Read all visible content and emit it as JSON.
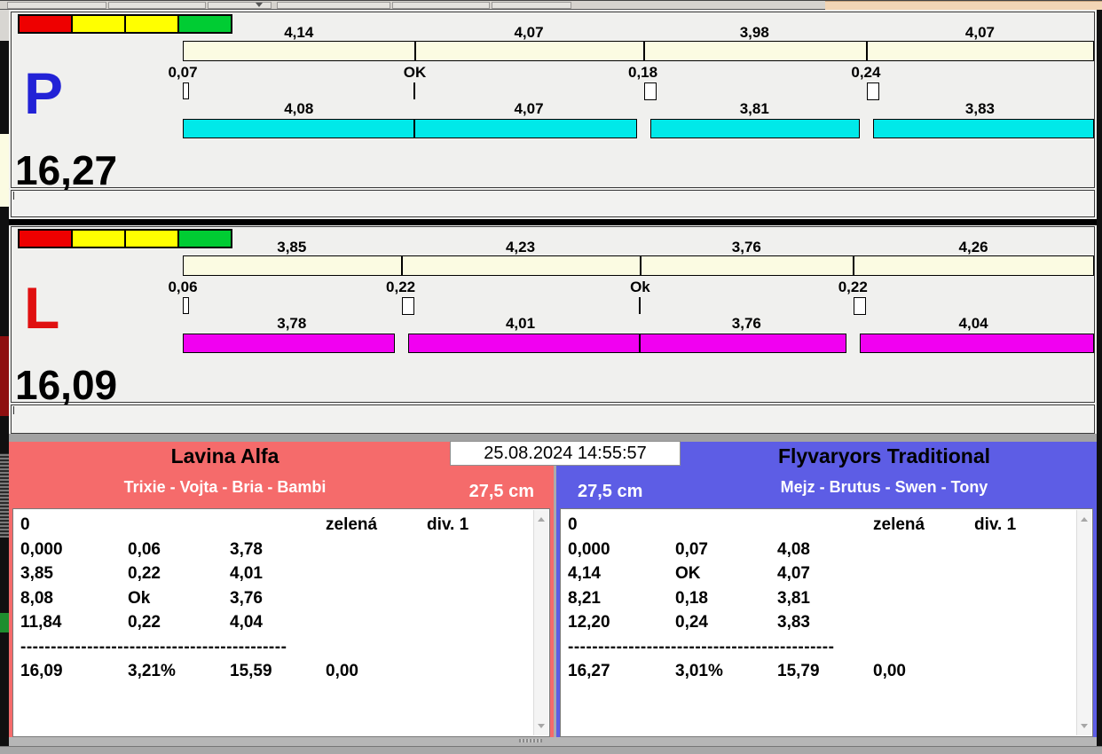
{
  "window": {
    "datetime": "25.08.2024 14:55:57"
  },
  "status_lights": {
    "colors": [
      "#EE0000",
      "#FFFF00",
      "#FFFF00",
      "#00CC33"
    ]
  },
  "lanes": [
    {
      "id": "P",
      "letter": "P",
      "letter_color": "#2222D6",
      "total": "16,27",
      "segment_bar_color": "#FBFBE2",
      "run_bar_color": "#00E9E9",
      "segments": [
        {
          "label": "4,14",
          "value": 4.14
        },
        {
          "label": "4,07",
          "value": 4.07
        },
        {
          "label": "3,98",
          "value": 3.98
        },
        {
          "label": "4,07",
          "value": 4.07
        }
      ],
      "splits": [
        {
          "label": "0,07",
          "marker": "start"
        },
        {
          "label": "OK",
          "marker": "ok"
        },
        {
          "label": "0,18",
          "marker": "fault"
        },
        {
          "label": "0,24",
          "marker": "fault"
        }
      ],
      "runs": [
        {
          "label": "4,08",
          "value": 4.08
        },
        {
          "label": "4,07",
          "value": 4.07
        },
        {
          "label": "3,81",
          "value": 3.81
        },
        {
          "label": "3,83",
          "value": 3.83
        }
      ]
    },
    {
      "id": "L",
      "letter": "L",
      "letter_color": "#E01010",
      "total": "16,09",
      "segment_bar_color": "#FBFBE2",
      "run_bar_color": "#F100F1",
      "segments": [
        {
          "label": "3,85",
          "value": 3.85
        },
        {
          "label": "4,23",
          "value": 4.23
        },
        {
          "label": "3,76",
          "value": 3.76
        },
        {
          "label": "4,26",
          "value": 4.26
        }
      ],
      "splits": [
        {
          "label": "0,06",
          "marker": "start"
        },
        {
          "label": "0,22",
          "marker": "fault"
        },
        {
          "label": "Ok",
          "marker": "ok"
        },
        {
          "label": "0,22",
          "marker": "fault"
        }
      ],
      "runs": [
        {
          "label": "3,78",
          "value": 3.78
        },
        {
          "label": "4,01",
          "value": 4.01
        },
        {
          "label": "3,76",
          "value": 3.76
        },
        {
          "label": "4,04",
          "value": 4.04
        }
      ]
    }
  ],
  "scoreboard": {
    "datetime": "25.08.2024 14:55:57",
    "teams": [
      {
        "name": "Lavina Alfa",
        "members": "Trixie - Vojta - Bria - Bambi",
        "jump_height": "27,5 cm",
        "accent_color": "#F56B6B",
        "log": {
          "status_row": {
            "col1": "0",
            "flag": "zelená",
            "division": "div. 1"
          },
          "rows": [
            [
              "0,000",
              "0,06",
              "3,78"
            ],
            [
              "3,85",
              "0,22",
              "4,01"
            ],
            [
              "8,08",
              "Ok",
              "3,76"
            ],
            [
              "11,84",
              "0,22",
              "4,04"
            ]
          ],
          "separator": "--------------------------------------------",
          "summary": [
            "16,09",
            "3,21%",
            "15,59",
            "0,00"
          ]
        }
      },
      {
        "name": "Flyvaryors Traditional",
        "members": "Mejz - Brutus - Swen - Tony",
        "jump_height": "27,5 cm",
        "accent_color": "#5D5DE5",
        "log": {
          "status_row": {
            "col1": "0",
            "flag": "zelená",
            "division": "div. 1"
          },
          "rows": [
            [
              "0,000",
              "0,07",
              "4,08"
            ],
            [
              "4,14",
              "OK",
              "4,07"
            ],
            [
              "8,21",
              "0,18",
              "3,81"
            ],
            [
              "12,20",
              "0,24",
              "3,83"
            ]
          ],
          "separator": "--------------------------------------------",
          "summary": [
            "16,27",
            "3,01%",
            "15,79",
            "0,00"
          ]
        }
      }
    ]
  }
}
